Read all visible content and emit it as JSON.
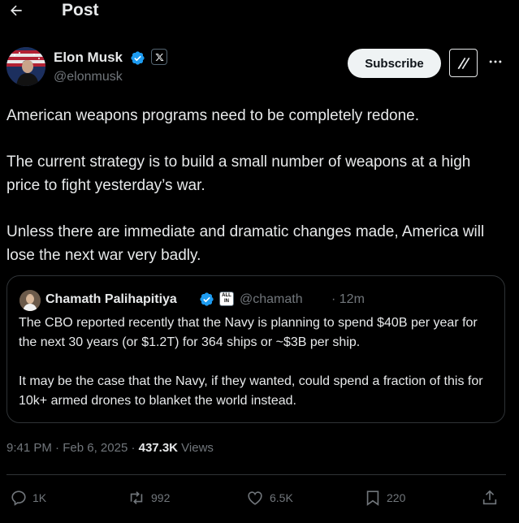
{
  "header": {
    "title": "Post"
  },
  "author": {
    "name": "Elon Musk",
    "handle": "@elonmusk"
  },
  "subscribe_label": "Subscribe",
  "post": {
    "paragraphs": [
      "American weapons programs need to be completely redone.",
      "The current strategy is to build a small number of weapons at a high price to fight yesterday’s war.",
      "Unless there are immediate and dramatic changes made, America will lose the next war very badly."
    ]
  },
  "quote": {
    "name": "Chamath Palihapitiya",
    "badge_text": "ALL IN",
    "handle": "@chamath",
    "time": "· 12m",
    "paragraphs": [
      "The CBO reported recently that the Navy is planning to spend $40B per year for the next 30 years (or $1.2T) for 364 ships or ~$3B per ship.",
      "It may be the case that the Navy, if they wanted, could spend a fraction of this for 10k+ armed drones to blanket the world instead."
    ]
  },
  "meta": {
    "time": "9:41 PM",
    "sep1": " · ",
    "date": "Feb 6, 2025",
    "sep2": " · ",
    "views_count": "437.3K",
    "views_label": " Views"
  },
  "actions": {
    "replies": "1K",
    "reposts": "992",
    "likes": "6.5K",
    "bookmarks": "220"
  },
  "colors": {
    "background": "#000000",
    "text": "#e7e9ea",
    "muted": "#71767b",
    "verified": "#1d9bf0",
    "border": "#2f3336"
  }
}
